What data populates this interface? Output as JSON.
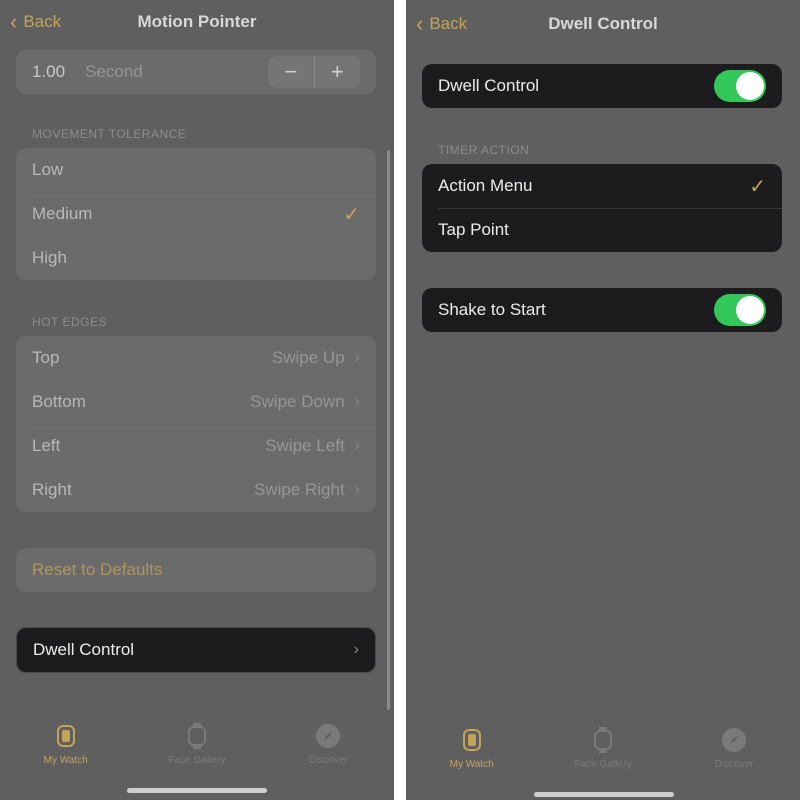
{
  "left": {
    "back": "Back",
    "title": "Motion Pointer",
    "stepper": {
      "value": "1.00",
      "unit": "Second",
      "minus": "−",
      "plus": "+"
    },
    "tolerance": {
      "header": "MOVEMENT TOLERANCE",
      "options": [
        "Low",
        "Medium",
        "High"
      ],
      "selected": "Medium"
    },
    "hot_edges": {
      "header": "HOT EDGES",
      "rows": [
        {
          "label": "Top",
          "value": "Swipe Up"
        },
        {
          "label": "Bottom",
          "value": "Swipe Down"
        },
        {
          "label": "Left",
          "value": "Swipe Left"
        },
        {
          "label": "Right",
          "value": "Swipe Right"
        }
      ]
    },
    "reset": "Reset to Defaults",
    "dwell": "Dwell Control"
  },
  "right": {
    "back": "Back",
    "title": "Dwell Control",
    "dwell_toggle": {
      "label": "Dwell Control",
      "on": true
    },
    "timer": {
      "header": "TIMER ACTION",
      "options": [
        "Action Menu",
        "Tap Point"
      ],
      "selected": "Action Menu"
    },
    "shake_toggle": {
      "label": "Shake to Start",
      "on": true
    }
  },
  "tabs": [
    {
      "label": "My Watch",
      "icon": "watch-face-icon"
    },
    {
      "label": "Face Gallery",
      "icon": "watch-icon"
    },
    {
      "label": "Discover",
      "icon": "compass-icon"
    }
  ],
  "colors": {
    "accent": "#c4a35a",
    "toggle_on": "#34c759",
    "panel_bg": "#5f5f5f",
    "card_dark": "#1c1c1e"
  }
}
